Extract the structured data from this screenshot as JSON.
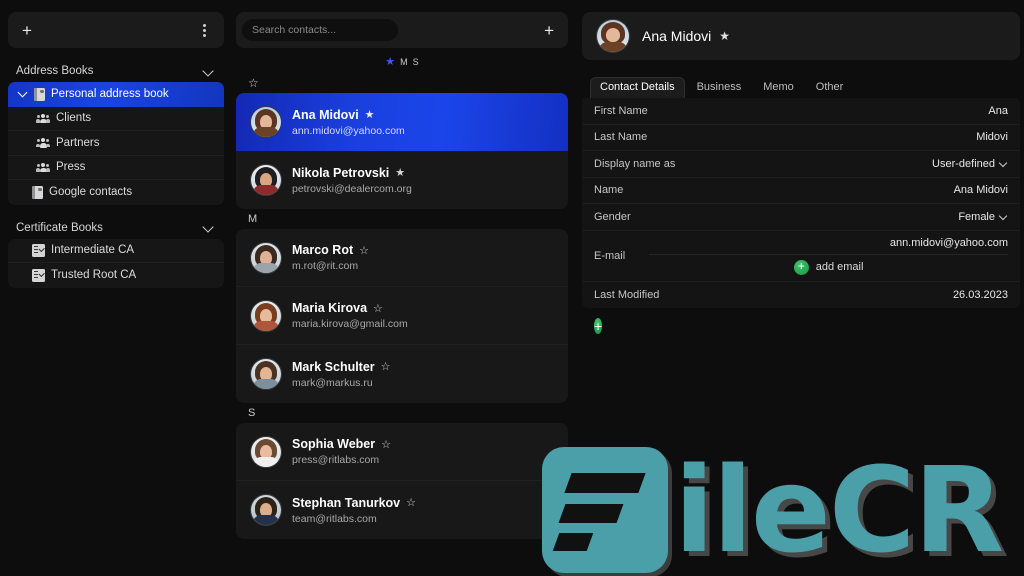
{
  "sidebar": {
    "toolbar": {
      "add_label": "+",
      "menu_label": "⋮"
    },
    "sections": [
      {
        "title": "Address Books",
        "items": [
          {
            "label": "Personal address book",
            "icon": "book-icon",
            "selected": true,
            "expandable": true
          },
          {
            "label": "Clients",
            "icon": "people-icon",
            "selected": false,
            "expandable": false
          },
          {
            "label": "Partners",
            "icon": "people-icon",
            "selected": false,
            "expandable": false
          },
          {
            "label": "Press",
            "icon": "people-icon",
            "selected": false,
            "expandable": false
          },
          {
            "label": "Google contacts",
            "icon": "book-icon",
            "selected": false,
            "expandable": false
          }
        ]
      },
      {
        "title": "Certificate Books",
        "items": [
          {
            "label": "Intermediate CA",
            "icon": "certificate-icon",
            "selected": false,
            "expandable": false
          },
          {
            "label": "Trusted Root CA",
            "icon": "certificate-icon",
            "selected": false,
            "expandable": false
          }
        ]
      }
    ]
  },
  "contact_list": {
    "search": {
      "placeholder": "Search contacts...",
      "value": ""
    },
    "add_label": "+",
    "index": [
      "★",
      "M",
      "S"
    ],
    "groups": [
      {
        "header": "☆",
        "header_type": "star",
        "contacts": [
          {
            "name": "Ana Midovi",
            "email": "ann.midovi@yahoo.com",
            "starred": "★",
            "selected": true
          },
          {
            "name": "Nikola Petrovski",
            "email": "petrovski@dealercom.org",
            "starred": "★",
            "selected": false
          }
        ]
      },
      {
        "header": "M",
        "header_type": "letter",
        "contacts": [
          {
            "name": "Marco Rot",
            "email": "m.rot@rit.com",
            "starred": "☆",
            "selected": false
          },
          {
            "name": "Maria Kirova",
            "email": "maria.kirova@gmail.com",
            "starred": "☆",
            "selected": false
          },
          {
            "name": "Mark Schulter",
            "email": "mark@markus.ru",
            "starred": "☆",
            "selected": false
          }
        ]
      },
      {
        "header": "S",
        "header_type": "letter",
        "contacts": [
          {
            "name": "Sophia Weber",
            "email": "press@ritlabs.com",
            "starred": "☆",
            "selected": false
          },
          {
            "name": "Stephan Tanurkov",
            "email": "team@ritlabs.com",
            "starred": "☆",
            "selected": false
          }
        ]
      }
    ]
  },
  "detail": {
    "header": {
      "name": "Ana Midovi",
      "starred": "★"
    },
    "tabs": [
      {
        "label": "Contact Details",
        "active": true
      },
      {
        "label": "Business",
        "active": false
      },
      {
        "label": "Memo",
        "active": false
      },
      {
        "label": "Other",
        "active": false
      }
    ],
    "fields": [
      {
        "label": "First Name",
        "value": "Ana",
        "dropdown": false
      },
      {
        "label": "Last Name",
        "value": "Midovi",
        "dropdown": false
      },
      {
        "label": "Display name as",
        "value": "User-defined",
        "dropdown": true
      },
      {
        "label": "Name",
        "value": "Ana Midovi",
        "dropdown": false
      },
      {
        "label": "Gender",
        "value": "Female",
        "dropdown": true
      }
    ],
    "email_field": {
      "label": "E-mail",
      "value": "ann.midovi@yahoo.com",
      "add_label": "add email"
    },
    "last_modified": {
      "label": "Last Modified",
      "value": "26.03.2023"
    },
    "add_field_label": "+"
  },
  "watermark": {
    "text": "ileCR",
    "color": "#4a9fa9"
  }
}
